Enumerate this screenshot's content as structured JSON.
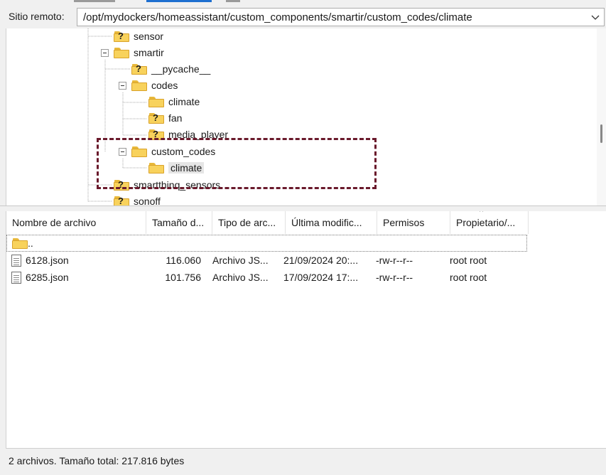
{
  "site_bar": {
    "label": "Sitio remoto:",
    "path": "/opt/mydockers/homeassistant/custom_components/smartir/custom_codes/climate",
    "dropdown_icon": "chevron-down-icon"
  },
  "tree": {
    "items": [
      {
        "label": "sensor",
        "icon": "unknown-folder-icon"
      },
      {
        "label": "smartir",
        "icon": "folder-icon"
      },
      {
        "label": "__pycache__",
        "icon": "unknown-folder-icon"
      },
      {
        "label": "codes",
        "icon": "folder-icon"
      },
      {
        "label": "climate",
        "icon": "folder-icon"
      },
      {
        "label": "fan",
        "icon": "unknown-folder-icon"
      },
      {
        "label": "media_player",
        "icon": "unknown-folder-icon"
      },
      {
        "label": "custom_codes",
        "icon": "folder-icon"
      },
      {
        "label": "climate",
        "icon": "folder-icon",
        "selected": true
      },
      {
        "label": "smartthinq_sensors",
        "icon": "unknown-folder-icon"
      },
      {
        "label": "sonoff",
        "icon": "unknown-folder-icon"
      }
    ]
  },
  "file_list": {
    "columns": [
      "Nombre de archivo",
      "Tamaño d...",
      "Tipo de arc...",
      "Última modific...",
      "Permisos",
      "Propietario/..."
    ],
    "sort_icon": "sort-up-icon",
    "parent_row": {
      "name": ".."
    },
    "rows": [
      {
        "name": "6128.json",
        "size": "116.060",
        "type": "Archivo JS...",
        "modified": "21/09/2024 20:...",
        "permissions": "-rw-r--r--",
        "owner": "root root"
      },
      {
        "name": "6285.json",
        "size": "101.756",
        "type": "Archivo JS...",
        "modified": "17/09/2024 17:...",
        "permissions": "-rw-r--r--",
        "owner": "root root"
      }
    ]
  },
  "status": {
    "text": "2 archivos. Tamaño total: 217.816 bytes"
  },
  "colors": {
    "annotation": "#6a1a2c",
    "folder": "#f8d25c",
    "accent": "#1e6fd0"
  }
}
